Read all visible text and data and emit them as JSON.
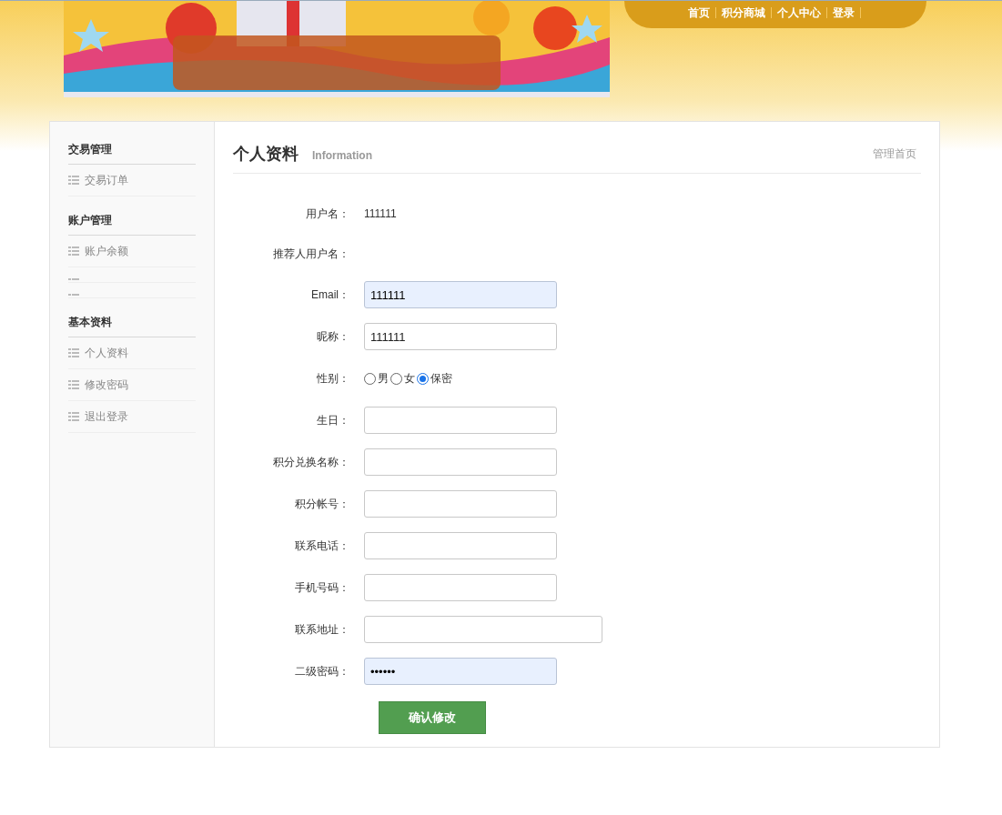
{
  "header": {
    "nav": [
      "首页",
      "积分商城",
      "个人中心",
      "登录"
    ]
  },
  "sidebar": {
    "groups": [
      {
        "title": "交易管理",
        "items": [
          {
            "kind": "link",
            "label": "交易订单"
          }
        ]
      },
      {
        "title": "账户管理",
        "items": [
          {
            "kind": "link",
            "label": "账户余额"
          },
          {
            "kind": "blank"
          },
          {
            "kind": "blank"
          }
        ]
      },
      {
        "title": "基本资料",
        "items": [
          {
            "kind": "link",
            "label": "个人资料"
          },
          {
            "kind": "link",
            "label": "修改密码"
          },
          {
            "kind": "link",
            "label": "退出登录"
          }
        ]
      }
    ]
  },
  "main": {
    "title": "个人资料",
    "subtitle": "Information",
    "home_link": "管理首页",
    "form": [
      {
        "kind": "text",
        "label": "用户名：",
        "value": "111111"
      },
      {
        "kind": "text",
        "label": "推荐人用户名："
      },
      {
        "kind": "input",
        "label": "Email：",
        "value": "111111",
        "autofilled": true
      },
      {
        "kind": "input",
        "label": "昵称：",
        "value": "111111",
        "autofilled": false
      },
      {
        "kind": "radio",
        "label": "性别：",
        "options": [
          {
            "label": "男",
            "selected": false
          },
          {
            "label": "女",
            "selected": false
          },
          {
            "label": "保密",
            "selected": true
          }
        ]
      },
      {
        "kind": "input",
        "label": "生日：",
        "autofilled": false
      },
      {
        "kind": "input",
        "label": "积分兑换名称：",
        "autofilled": false
      },
      {
        "kind": "input",
        "label": "积分帐号：",
        "autofilled": false
      },
      {
        "kind": "input",
        "label": "联系电话：",
        "autofilled": false
      },
      {
        "kind": "input",
        "label": "手机号码：",
        "autofilled": false
      },
      {
        "kind": "wide_input",
        "label": "联系地址：",
        "autofilled": false
      },
      {
        "kind": "input",
        "label": "二级密码：",
        "value": "••••••",
        "autofilled": true
      }
    ],
    "submit": "确认修改"
  }
}
